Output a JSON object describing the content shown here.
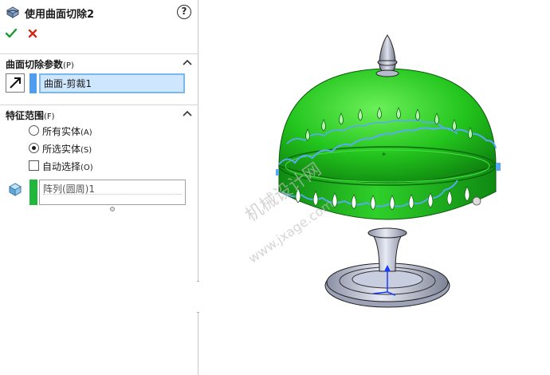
{
  "header": {
    "title": "使用曲面切除2",
    "help_icon": "help-icon",
    "ok_icon": "check-icon",
    "cancel_icon": "close-icon",
    "help_glyph": "?"
  },
  "surface_cut": {
    "title": "曲面切除参数",
    "hotkey": "(P)",
    "selected_surface": "曲面-剪裁1",
    "flip_icon": "flip-direction-icon",
    "swatch_color": "#4d9df0"
  },
  "feature_scope": {
    "title": "特征范围",
    "hotkey": "(F)",
    "options": [
      {
        "label": "所有实体",
        "hotkey": "(A)",
        "checked": false
      },
      {
        "label": "所选实体",
        "hotkey": "(S)",
        "checked": true
      }
    ],
    "auto_select": {
      "label": "自动选择",
      "hotkey": "(O)",
      "checked": false
    },
    "selected_bodies": [
      "阵列(圆周)1"
    ],
    "body_icon": "solid-body-icon",
    "swatch_color": "#1fb83c"
  },
  "viewport": {
    "model_color": "#22c41f",
    "watermark_line1": "机械设计网",
    "watermark_line2": "www.jxage.com"
  }
}
